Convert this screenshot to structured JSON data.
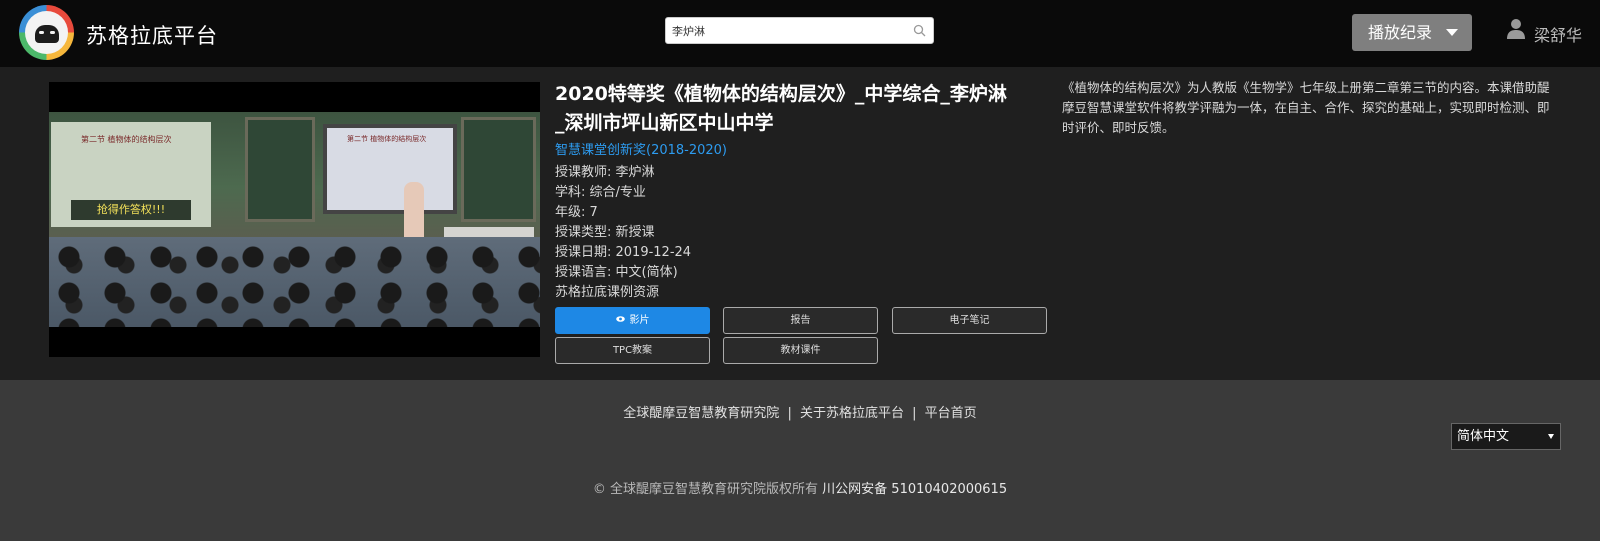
{
  "header": {
    "brand": "苏格拉底平台",
    "search_value": "李炉淋",
    "history_label": "播放纪录",
    "user_name": "梁舒华"
  },
  "video": {
    "title_line1": "2020特等奖《植物体的结构层次》_中学综合_李炉淋",
    "title_line2": "_深圳市坪山新区中山中学",
    "award": "智慧课堂创新奖(2018-2020)",
    "thumbnail": {
      "board_title": "第二节 植物体的结构层次",
      "sticker": "抢得作答权!!!",
      "screen_title": "第二节 植物体的结构层次"
    },
    "info": [
      "授课教师: 李炉淋",
      "学科: 综合/专业",
      "年级: 7",
      "授课类型: 新授课",
      "授课日期: 2019-12-24",
      "授课语言: 中文(简体)",
      "苏格拉底课例资源"
    ],
    "buttons": {
      "video": "影片",
      "report": "报告",
      "notes": "电子笔记",
      "tpc": "TPC教案",
      "materials": "教材课件"
    },
    "description": "《植物体的结构层次》为人教版《生物学》七年级上册第二章第三节的内容。本课借助醍摩豆智慧课堂软件将教学评融为一体，在自主、合作、探究的基础上，实现即时检测、即时评价、即时反馈。"
  },
  "footer": {
    "link1": "全球醍摩豆智慧教育研究院",
    "link2": "关于苏格拉底平台",
    "link3": "平台首页",
    "separator": "|",
    "language": "简体中文",
    "copyright": "© 全球醍摩豆智慧教育研究院版权所有",
    "icp": "川公网安备 51010402000615"
  },
  "colors": {
    "topbar": "#0a0a0a",
    "panel": "#1f1f1f",
    "footer": "#3a3a3a",
    "accent": "#1e88e5",
    "award_link": "#2d9bef"
  }
}
